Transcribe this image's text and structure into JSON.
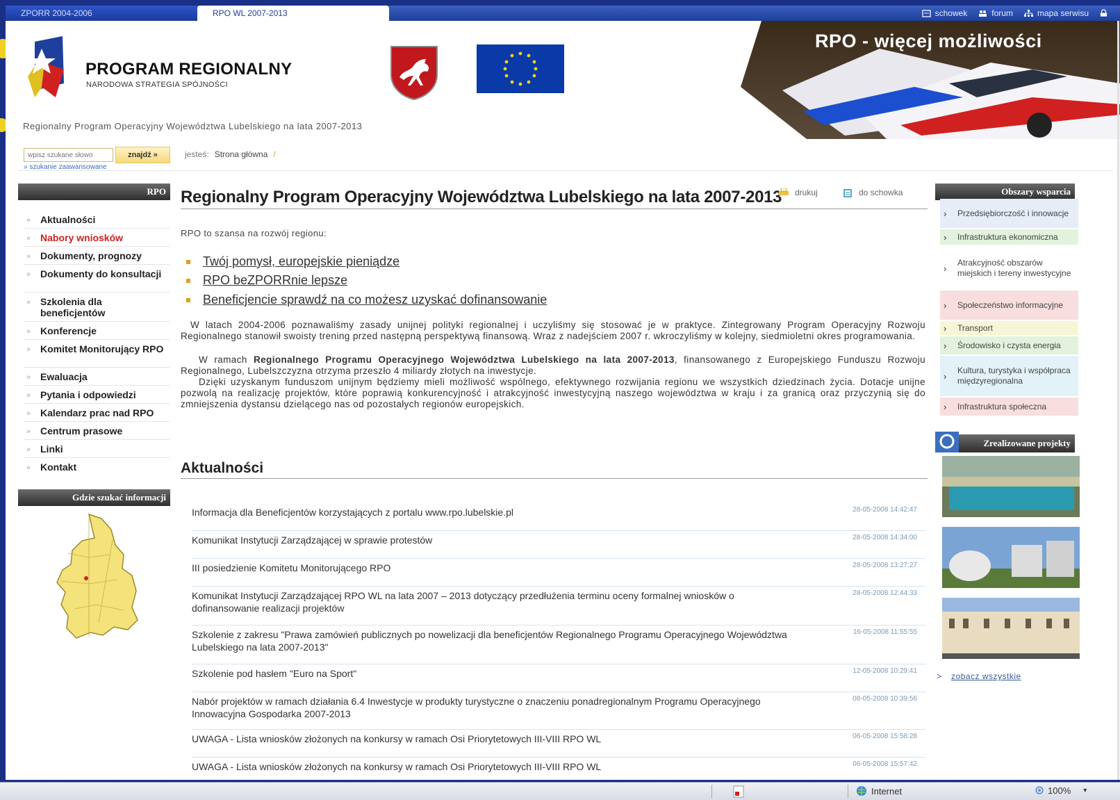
{
  "colors": {
    "brand_blue": "#1e3f9c",
    "nav_active": "#cc2222",
    "search_button": "#f6d97a",
    "date_text": "#7a9ab6"
  },
  "topbar": {
    "tabs": [
      "ZPORR 2004-2006",
      "RPO WL 2007-2013"
    ],
    "links": {
      "schowek": "schowek",
      "forum": "forum",
      "mapa": "mapa serwisu"
    }
  },
  "header": {
    "logo_title": "PROGRAM REGIONALNY",
    "logo_subtitle": "NARODOWA STRATEGIA SPÓJNOŚCI",
    "banner_text": "RPO - więcej możliwości",
    "site_subtitle": "Regionalny Program Operacyjny Województwa Lubelskiego na lata 2007-2013"
  },
  "search": {
    "placeholder": "wpisz szukane słowo",
    "button": "znajdź »",
    "advanced": "» szukanie zaawansowane"
  },
  "breadcrumb": {
    "prefix": "jesteś:",
    "current": "Strona główna",
    "sep": "/"
  },
  "left_nav": {
    "heading": "RPO",
    "items": [
      {
        "label": "Aktualności",
        "active": false
      },
      {
        "label": "Nabory wniosków",
        "active": true
      },
      {
        "label": "Dokumenty, prognozy",
        "active": false
      },
      {
        "label": "Dokumenty do konsultacji",
        "active": false
      },
      {
        "label": "Szkolenia dla beneficjentów",
        "active": false
      },
      {
        "label": "Konferencje",
        "active": false
      },
      {
        "label": "Komitet Monitorujący RPO",
        "active": false
      },
      {
        "label": "Ewaluacja",
        "active": false
      },
      {
        "label": "Pytania i odpowiedzi",
        "active": false
      },
      {
        "label": "Kalendarz prac nad RPO",
        "active": false
      },
      {
        "label": "Centrum prasowe",
        "active": false
      },
      {
        "label": "Linki",
        "active": false
      },
      {
        "label": "Kontakt",
        "active": false
      }
    ],
    "info_heading": "Gdzie szukać informacji"
  },
  "main": {
    "title": "Regionalny Program Operacyjny Województwa Lubelskiego na lata 2007-2013",
    "print": "drukuj",
    "clipboard": "do schowka",
    "intro": "RPO to szansa na rozwój regionu:",
    "bullets": [
      "Twój pomysł, europejskie pieniądze",
      "RPO beZPORRnie lepsze",
      "Beneficjencie sprawdź na co możesz uzyskać dofinansowanie"
    ],
    "p1": "W latach 2004-2006 poznawaliśmy zasady unijnej polityki regionalnej i uczyliśmy się stosować je w praktyce. Zintegrowany Program Operacyjny Rozwoju Regionalnego stanowił swoisty trening przed następną perspektywą finansową. Wraz z nadejściem 2007 r. wkroczyliśmy w kolejny, siedmioletni okres programowania.",
    "p2_a": "W ramach ",
    "p2_b": "Regionalnego Programu Operacyjnego Województwa Lubelskiego na lata 2007-2013",
    "p2_c": ", finansowanego z Europejskiego Funduszu Rozwoju Regionalnego, Lubelszczyzna otrzyma przeszło 4 miliardy złotych na inwestycje.",
    "p3": "Dzięki uzyskanym funduszom unijnym będziemy mieli możliwość wspólnego, efektywnego rozwijania regionu we wszystkich dziedzinach życia. Dotacje unijne pozwolą na realizację projektów, które poprawią konkurencyjność i atrakcyjność inwestycyjną naszego województwa w kraju i za granicą oraz przyczynią się do zmniejszenia dystansu dzielącego nas od pozostałych regionów europejskich.",
    "news_heading": "Aktualności",
    "news": [
      {
        "title": "Informacja dla Beneficjentów korzystających z portalu www.rpo.lubelskie.pl",
        "date": "28-05-2008 14:42:47"
      },
      {
        "title": "Komunikat Instytucji Zarządzającej w sprawie protestów",
        "date": "28-05-2008 14:34:00"
      },
      {
        "title": "III posiedzienie Komitetu Monitorującego RPO",
        "date": "28-05-2008 13:27:27"
      },
      {
        "title": "Komunikat Instytucji Zarządzającej RPO WL na lata 2007 – 2013 dotyczący przedłużenia terminu oceny formalnej wniosków o dofinansowanie realizacji projektów",
        "date": "28-05-2008 12:44:33"
      },
      {
        "title": "Szkolenie z zakresu \"Prawa zamówień publicznych po nowelizacji dla beneficjentów Regionalnego Programu Operacyjnego Województwa Lubelskiego na lata 2007-2013\"",
        "date": "16-05-2008 11:55:55"
      },
      {
        "title": "Szkolenie pod hasłem \"Euro na Sport\"",
        "date": "12-05-2008 10:29:41"
      },
      {
        "title": "Nabór projektów w ramach działania 6.4 Inwestycje w produkty turystyczne o znaczeniu ponadregionalnym Programu Operacyjnego Innowacyjna Gospodarka 2007-2013",
        "date": "08-05-2008 10:39:56"
      },
      {
        "title": "UWAGA - Lista wniosków złożonych na konkursy w ramach Osi Priorytetowych III-VIII RPO WL",
        "date": "06-05-2008 15:58:28"
      },
      {
        "title": "UWAGA - Lista wniosków złożonych na konkursy w ramach Osi Priorytetowych III-VIII RPO WL",
        "date": "06-05-2008 15:57:42"
      }
    ]
  },
  "right": {
    "heading": "Obszary wsparcia",
    "items": [
      {
        "label": "Przedsiębiorczość i innowacje",
        "bg": "#e6ecf8"
      },
      {
        "label": "Infrastruktura ekonomiczna",
        "bg": "#e2f2dc"
      },
      {
        "label": "Atrakcyjność obszarów miejskich i tereny inwestycyjne",
        "bg": "#ffffff"
      },
      {
        "label": "Społeczeństwo informacyjne",
        "bg": "#f8dede"
      },
      {
        "label": "Transport",
        "bg": "#f6f6d6"
      },
      {
        "label": "Środowisko i czysta energia",
        "bg": "#e2f2dc"
      },
      {
        "label": "Kultura, turystyka i współpraca międzyregionalna",
        "bg": "#e2f2f8"
      },
      {
        "label": "Infrastruktura społeczna",
        "bg": "#f8dede"
      }
    ],
    "projects_heading": "Zrealizowane projekty",
    "see_all": "zobacz wszystkie"
  },
  "statusbar": {
    "zone": "Internet",
    "zoom": "100%"
  }
}
